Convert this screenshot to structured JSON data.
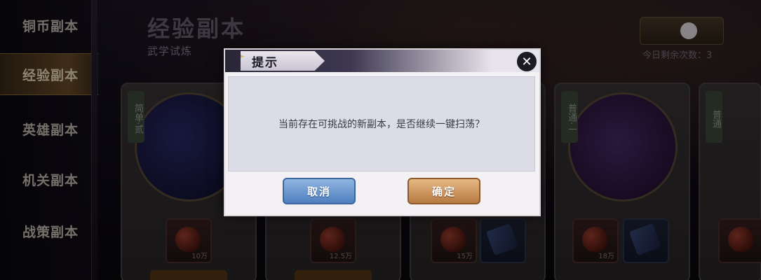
{
  "sidebar": {
    "items": [
      {
        "label": "铜币副本"
      },
      {
        "label": "经验副本"
      },
      {
        "label": "英雄副本"
      },
      {
        "label": "机关副本"
      },
      {
        "label": "战策副本"
      }
    ],
    "active_index": 1
  },
  "header": {
    "title": "经验副本",
    "subtitle": "武学试炼",
    "remaining_label": "今日剩余次数：3"
  },
  "cards": [
    {
      "tag": "简单·贰",
      "rewards": [
        {
          "qty": "10万"
        }
      ]
    },
    {
      "tag": "",
      "rewards": [
        {
          "qty": "12.5万"
        }
      ]
    },
    {
      "tag": "",
      "rewards": [
        {
          "qty": "15万"
        },
        {
          "qty": ""
        }
      ]
    },
    {
      "tag": "普通·一",
      "rewards": [
        {
          "qty": "18万"
        },
        {
          "qty": ""
        }
      ]
    },
    {
      "tag": "普通",
      "rewards": [
        {
          "qty": ""
        }
      ]
    }
  ],
  "dialog": {
    "title": "提示",
    "close_icon": "✕",
    "message": "当前存在可挑战的新副本，是否继续一键扫荡？",
    "cancel_label": "取消",
    "confirm_label": "确定"
  },
  "colors": {
    "cancel_button": "#5f8fcf",
    "confirm_button": "#c98a4e",
    "active_tab": "#6b4e2a"
  }
}
